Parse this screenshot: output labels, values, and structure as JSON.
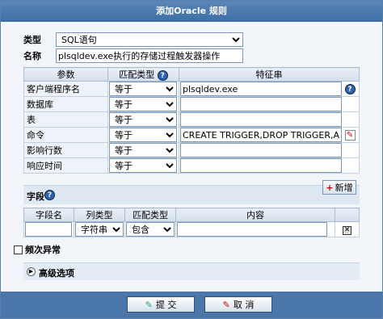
{
  "window": {
    "title": "添加Oracle 规则"
  },
  "form": {
    "type_label": "类型",
    "type_value": "SQL语句",
    "name_label": "名称",
    "name_value": "plsqldev.exe执行的存储过程触发器操作"
  },
  "params": {
    "headers": [
      "参数",
      "匹配类型",
      "特征串"
    ],
    "rows": [
      {
        "name": "客户端程序名",
        "match": "等于",
        "value": "plsqldev.exe"
      },
      {
        "name": "数据库",
        "match": "等于",
        "value": ""
      },
      {
        "name": "表",
        "match": "等于",
        "value": ""
      },
      {
        "name": "命令",
        "match": "等于",
        "value": "CREATE TRIGGER,DROP TRIGGER,ALTE"
      },
      {
        "name": "影响行数",
        "match": "等于",
        "value": ""
      },
      {
        "name": "响应时间",
        "match": "等于",
        "value": ""
      }
    ]
  },
  "fields": {
    "label": "字段",
    "add_button": "新增",
    "headers": [
      "字段名",
      "列类型",
      "匹配类型",
      "内容"
    ],
    "row": {
      "name": "",
      "col_type": "字符串",
      "match": "包含",
      "content": ""
    }
  },
  "frequent": {
    "label": "频次异常"
  },
  "advanced": {
    "label": "高级选项"
  },
  "footer": {
    "submit": "提 交",
    "cancel": "取 消"
  },
  "icons": {
    "help": "?",
    "add": "+",
    "edit": "pencil",
    "delete": "x"
  }
}
